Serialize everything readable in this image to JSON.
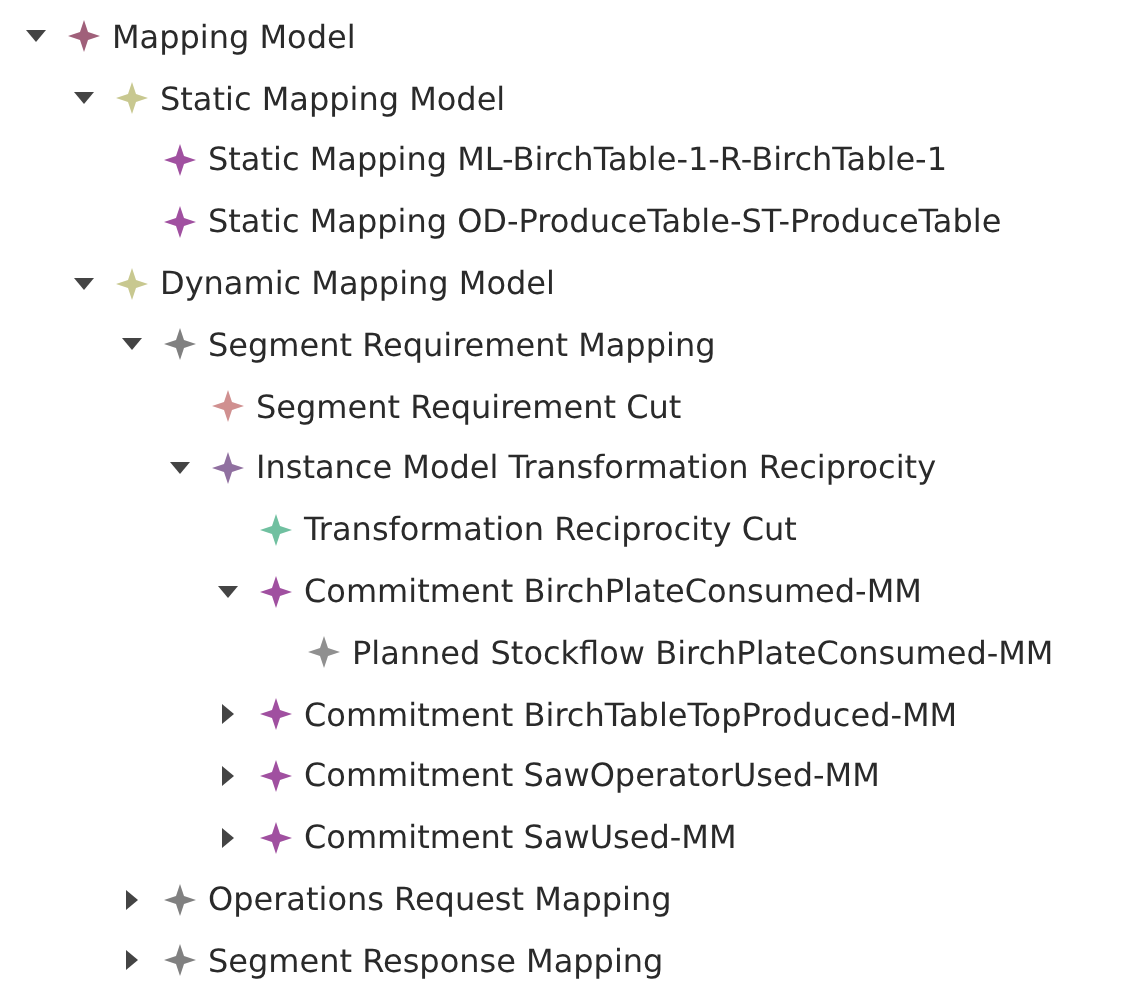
{
  "tree": [
    {
      "label": "Mapping Model",
      "color": "#a0607a",
      "expanded": true,
      "children": [
        {
          "label": "Static Mapping Model",
          "color": "#c8c890",
          "expanded": true,
          "children": [
            {
              "label": "Static Mapping ML-BirchTable-1-R-BirchTable-1",
              "color": "#a050a0"
            },
            {
              "label": "Static Mapping OD-ProduceTable-ST-ProduceTable",
              "color": "#a050a0"
            }
          ]
        },
        {
          "label": "Dynamic Mapping Model",
          "color": "#c8c890",
          "expanded": true,
          "children": [
            {
              "label": "Segment Requirement Mapping",
              "color": "#808080",
              "expanded": true,
              "children": [
                {
                  "label": "Segment Requirement Cut",
                  "color": "#d09090"
                },
                {
                  "label": "Instance Model Transformation Reciprocity",
                  "color": "#9070a0",
                  "expanded": true,
                  "children": [
                    {
                      "label": "Transformation Reciprocity Cut",
                      "color": "#70c0a0"
                    },
                    {
                      "label": "Commitment BirchPlateConsumed-MM",
                      "color": "#a050a0",
                      "expanded": true,
                      "children": [
                        {
                          "label": "Planned Stockflow BirchPlateConsumed-MM",
                          "color": "#909090"
                        }
                      ]
                    },
                    {
                      "label": "Commitment BirchTableTopProduced-MM",
                      "color": "#a050a0",
                      "expanded": false
                    },
                    {
                      "label": "Commitment SawOperatorUsed-MM",
                      "color": "#a050a0",
                      "expanded": false
                    },
                    {
                      "label": "Commitment SawUsed-MM",
                      "color": "#a050a0",
                      "expanded": false
                    }
                  ]
                }
              ]
            },
            {
              "label": "Operations Request Mapping",
              "color": "#808080",
              "expanded": false
            },
            {
              "label": "Segment Response Mapping",
              "color": "#808080",
              "expanded": false
            }
          ]
        }
      ]
    }
  ]
}
